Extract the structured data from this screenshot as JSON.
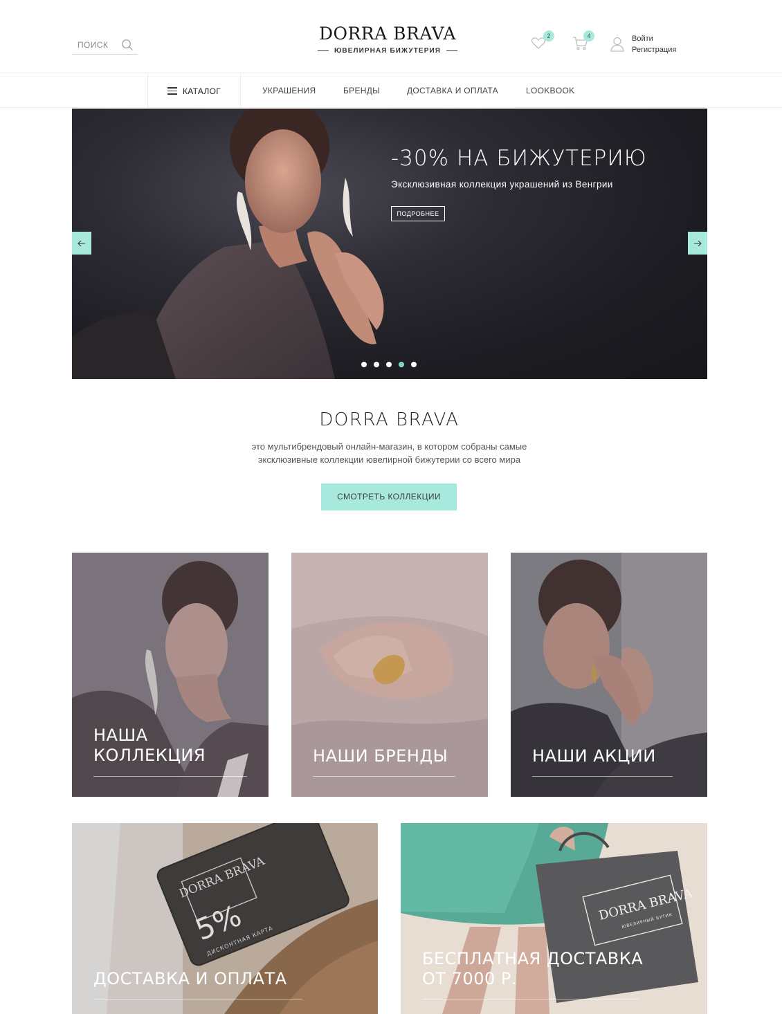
{
  "header": {
    "search_placeholder": "ПОИСК",
    "logo_title": "DORRA BRAVA",
    "logo_subtitle": "ЮВЕЛИРНАЯ БИЖУТЕРИЯ",
    "favorites_count": "2",
    "cart_count": "4",
    "login_label": "Войти",
    "register_label": "Регистрация"
  },
  "nav": {
    "catalog_label": "КАТАЛОГ",
    "links": [
      "УКРАШЕНИЯ",
      "БРЕНДЫ",
      "ДОСТАВКА И ОПЛАТА",
      "LOOKBOOK"
    ]
  },
  "hero": {
    "title": "-30% НА БИЖУТЕРИЮ",
    "subtitle": "Эксклюзивная коллекция украшений из Венгрии",
    "button_label": "ПОДРОБНЕЕ",
    "slide_count": 5,
    "active_slide": 4
  },
  "about": {
    "title": "DORRA BRAVA",
    "text_line1": "это мультибрендовый онлайн-магазин, в котором собраны самые",
    "text_line2": "эксклюзивные коллекции ювелирной бижутерии со всего мира",
    "button_label": "СМОТРЕТЬ КОЛЛЕКЦИИ"
  },
  "tiles": [
    {
      "label": "НАША\nКОЛЛЕКЦИЯ"
    },
    {
      "label": "НАШИ БРЕНДЫ"
    },
    {
      "label": "НАШИ АКЦИИ"
    },
    {
      "label": "ДОСТАВКА И ОПЛАТА",
      "card_logo": "DORRA BRAVA",
      "card_text": "5%",
      "card_caption": "ДИСКОНТНАЯ КАРТА"
    },
    {
      "label": "БЕСПЛАТНАЯ ДОСТАВКА\nОТ 7000 Р.",
      "bag_logo": "DORRA BRAVA",
      "bag_caption": "ЮВЕЛИРНЫЙ БУТИК"
    }
  ],
  "colors": {
    "accent": "#a7e9dc",
    "accent_dark": "#7fd8c6",
    "text": "#333333"
  }
}
